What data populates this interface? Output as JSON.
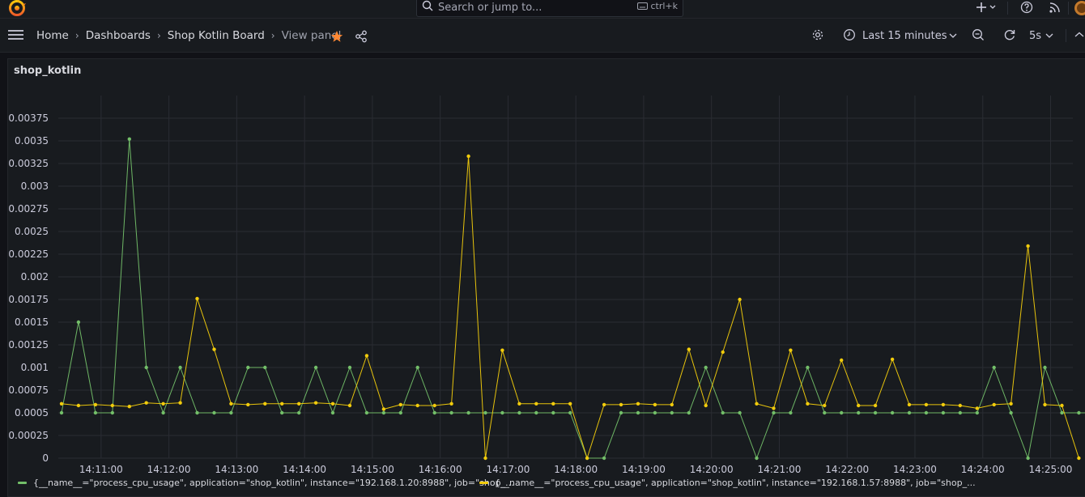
{
  "header": {
    "search_placeholder": "Search or jump to...",
    "search_shortcut": "ctrl+k"
  },
  "breadcrumb": {
    "items": [
      "Home",
      "Dashboards",
      "Shop Kotlin Board"
    ],
    "current": "View panel"
  },
  "toolbar": {
    "time_range": "Last 15 minutes",
    "refresh_interval": "5s"
  },
  "panel": {
    "title": "shop_kotlin"
  },
  "colors": {
    "series_green": "#73bf69",
    "series_yellow": "#f2cc0c",
    "grid": "#2a2c33",
    "text": "#ccccdc"
  },
  "chart_data": {
    "type": "line",
    "title": "shop_kotlin",
    "xlabel": "",
    "ylabel": "",
    "ylim": [
      0,
      0.004
    ],
    "y_ticks": [
      0,
      0.00025,
      0.0005,
      0.00075,
      0.001,
      0.00125,
      0.0015,
      0.00175,
      0.002,
      0.00225,
      0.0025,
      0.00275,
      0.003,
      0.00325,
      0.0035,
      0.00375
    ],
    "y_tick_labels": [
      "0",
      "0.00025",
      "0.0005",
      "0.00075",
      "0.001",
      "0.00125",
      "0.0015",
      "0.00175",
      "0.002",
      "0.00225",
      "0.0025",
      "0.00275",
      "0.003",
      "0.00325",
      "0.0035",
      "0.00375"
    ],
    "x_ticks": [
      "14:11:00",
      "14:12:00",
      "14:13:00",
      "14:14:00",
      "14:15:00",
      "14:16:00",
      "14:17:00",
      "14:18:00",
      "14:19:00",
      "14:20:00",
      "14:21:00",
      "14:22:00",
      "14:23:00",
      "14:24:00",
      "14:25:00"
    ],
    "x_start_time": "14:10:25",
    "x_step_seconds": 15,
    "grid": true,
    "legend": "bottom",
    "series": [
      {
        "name": "{__name__=\"process_cpu_usage\", application=\"shop_kotlin\", instance=\"192.168.1.20:8988\", job=\"shop_...",
        "color": "#73bf69",
        "values": [
          0.0005,
          0.0015,
          0.0005,
          0.0005,
          0.00352,
          0.001,
          0.0005,
          0.001,
          0.0005,
          0.0005,
          0.0005,
          0.001,
          0.001,
          0.0005,
          0.0005,
          0.001,
          0.0005,
          0.001,
          0.0005,
          0.0005,
          0.0005,
          0.001,
          0.0005,
          0.0005,
          0.0005,
          0.0005,
          0.0005,
          0.0005,
          0.0005,
          0.0005,
          0.0005,
          0.0,
          0.0,
          0.0005,
          0.0005,
          0.0005,
          0.0005,
          0.0005,
          0.001,
          0.0005,
          0.0005,
          0.0,
          0.0005,
          0.0005,
          0.001,
          0.0005,
          0.0005,
          0.0005,
          0.0005,
          0.0005,
          0.0005,
          0.0005,
          0.0005,
          0.0005,
          0.0005,
          0.001,
          0.0005,
          0.0,
          0.001,
          0.0005,
          0.0005,
          0.0005
        ]
      },
      {
        "name": "{__name__=\"process_cpu_usage\", application=\"shop_kotlin\", instance=\"192.168.1.57:8988\", job=\"shop_...",
        "color": "#f2cc0c",
        "values": [
          0.0006,
          0.00058,
          0.00059,
          0.00058,
          0.00057,
          0.00061,
          0.0006,
          0.00061,
          0.00176,
          0.0012,
          0.0006,
          0.00059,
          0.0006,
          0.0006,
          0.0006,
          0.00061,
          0.0006,
          0.00058,
          0.00113,
          0.00054,
          0.00059,
          0.00058,
          0.00058,
          0.0006,
          0.00333,
          0.0,
          0.00119,
          0.0006,
          0.0006,
          0.0006,
          0.0006,
          0.0,
          0.00059,
          0.00059,
          0.0006,
          0.00059,
          0.00059,
          0.0012,
          0.00058,
          0.00117,
          0.00175,
          0.0006,
          0.00055,
          0.00119,
          0.0006,
          0.00058,
          0.00108,
          0.00058,
          0.00058,
          0.00109,
          0.00059,
          0.00059,
          0.00059,
          0.00058,
          0.00055,
          0.00059,
          0.0006,
          0.00234,
          0.00059,
          0.00058,
          0.0
        ]
      }
    ]
  }
}
